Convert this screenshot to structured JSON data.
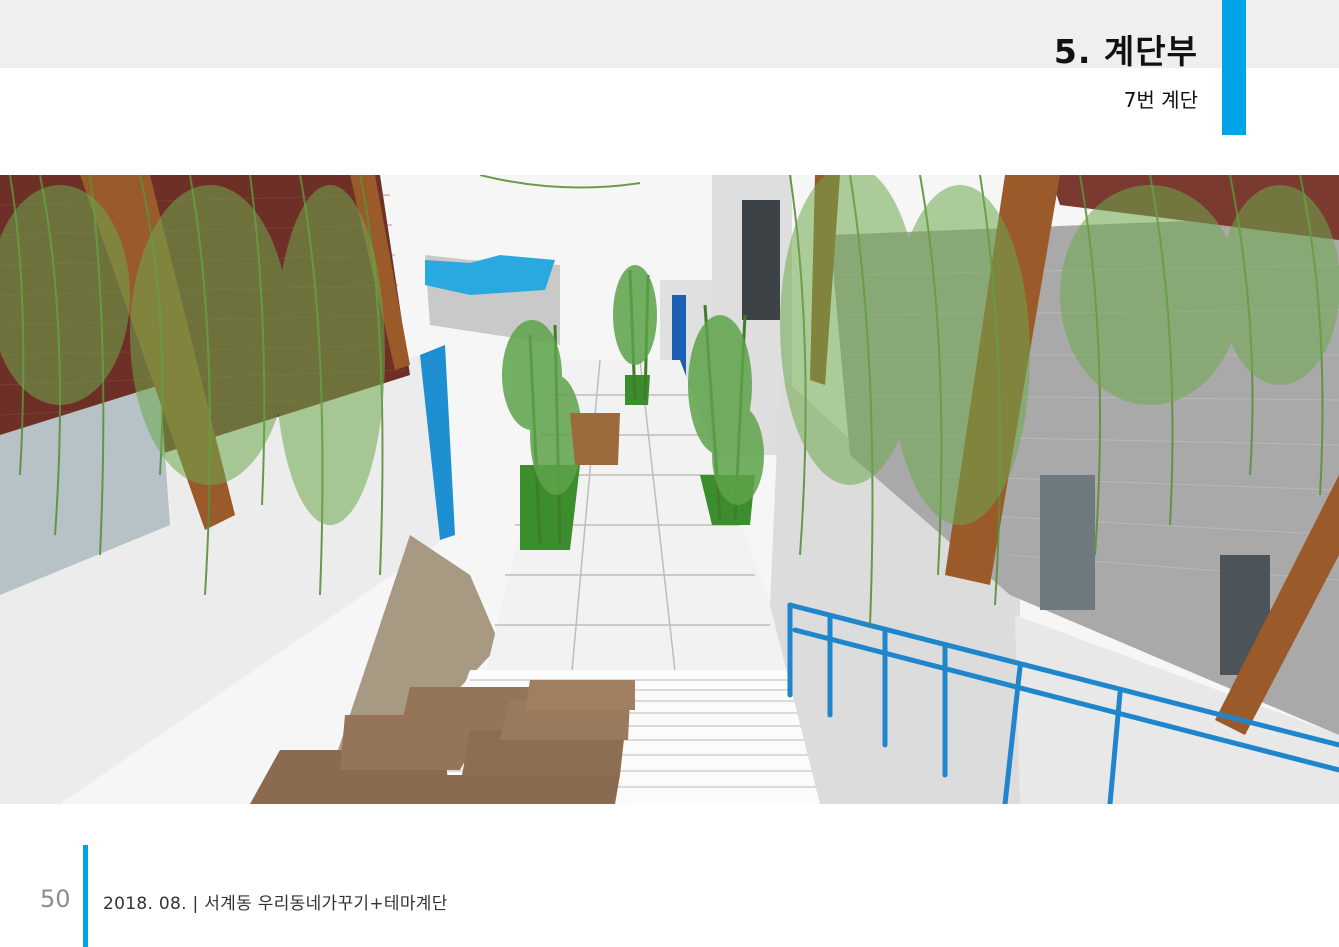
{
  "header": {
    "title": "5. 계단부",
    "subtitle": "7번 계단"
  },
  "footer": {
    "page_number": "50",
    "text": "2018. 08.  |  서계동 우리동네가꾸기+테마계단"
  },
  "colors": {
    "accent": "#00a3e8",
    "header_band": "#efefef"
  }
}
